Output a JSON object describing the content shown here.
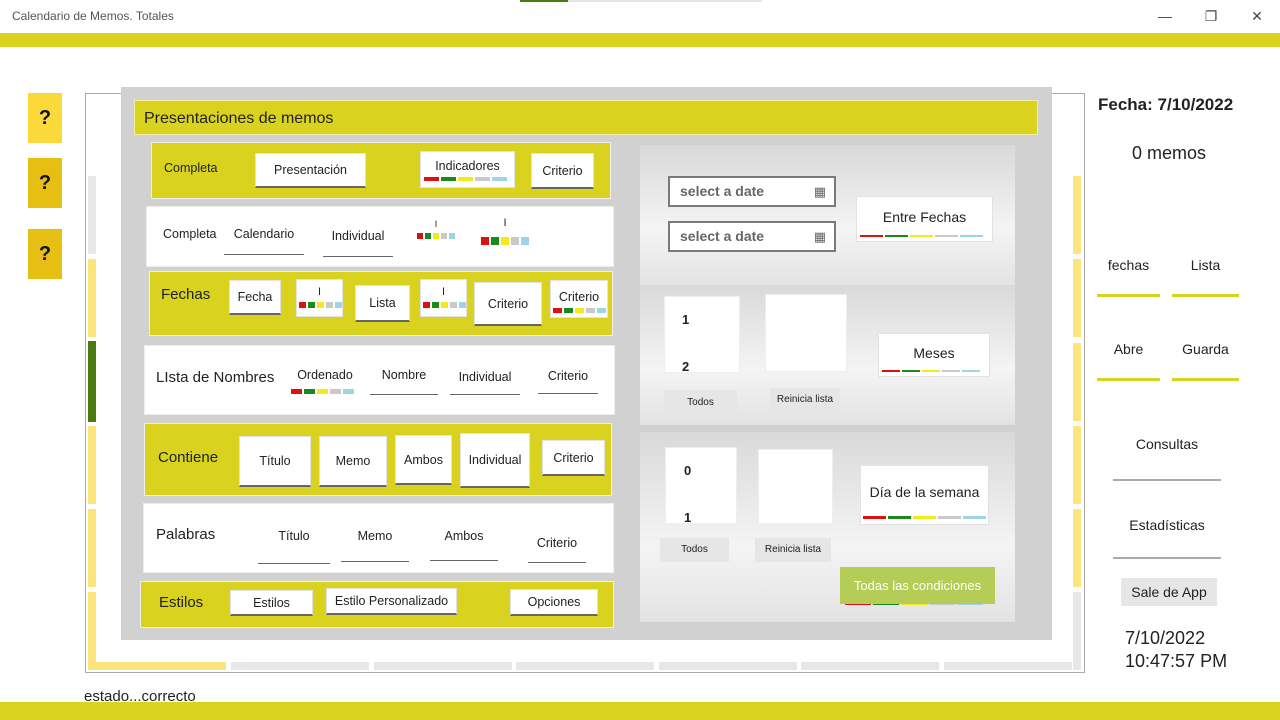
{
  "window": {
    "title": "Calendario de Memos. Totales",
    "minimize": "—",
    "restore": "❐",
    "close": "✕"
  },
  "help": [
    "?",
    "?",
    "?"
  ],
  "header": "Presentaciones de memos",
  "row1": {
    "label": "Completa",
    "b1": "Presentación",
    "b2": "Indicadores",
    "b3": "Criterio"
  },
  "row2": {
    "label": "Completa",
    "l1": "Calendario",
    "l2": "Individual",
    "i1": "I",
    "i2": "I"
  },
  "row3": {
    "label": "Fechas",
    "b1": "Fecha",
    "b2": "I",
    "b3": "Lista",
    "b4": "I",
    "b5": "Criterio",
    "b6": "Criterio"
  },
  "row4": {
    "label": "LIsta de Nombres",
    "l1": "Ordenado",
    "l2": "Nombre",
    "l3": "Individual",
    "l4": "Criterio"
  },
  "row5": {
    "label": "Contiene",
    "b1": "Título",
    "b2": "Memo",
    "b3": "Ambos",
    "b4": "Individual",
    "b5": "Criterio"
  },
  "row6": {
    "label": "Palabras",
    "l1": "Título",
    "l2": "Memo",
    "l3": "Ambos",
    "l4": "Criterio"
  },
  "row7": {
    "label": "Estilos",
    "b1": "Estilos",
    "b2": "Estilo Personalizado",
    "b3": "Opciones"
  },
  "dates": {
    "placeholder1": "select a date",
    "placeholder2": "select a date",
    "between": "Entre Fechas"
  },
  "months": {
    "n1": "1",
    "n2": "2",
    "todos": "Todos",
    "reset": "Reinicia  lista",
    "btn": "Meses"
  },
  "weekday": {
    "n1": "0",
    "n2": "1",
    "todos": "Todos",
    "reset": "Reinicia  lista",
    "btn": "Día de la semana"
  },
  "all_conditions": "Todas las condiciones",
  "right": {
    "fecha": "Fecha: 7/10/2022",
    "count": "0 memos",
    "fechas": "fechas",
    "lista": "Lista",
    "abre": "Abre",
    "guarda": "Guarda",
    "consultas": "Consultas",
    "estadisticas": "Estadísticas",
    "sale": "Sale de App",
    "date": "7/10/2022",
    "time": "10:47:57 PM"
  },
  "status": "estado...correcto",
  "colors": {
    "accent": "#d9d21e",
    "indicators": [
      "#e01010",
      "#1a8a1a",
      "#f3ea1a",
      "#c9c9c9",
      "#9fd3e6"
    ]
  }
}
